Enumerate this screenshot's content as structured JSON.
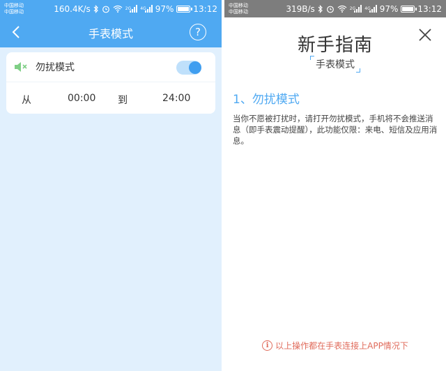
{
  "left": {
    "status": {
      "carrier_line1": "中国移动",
      "carrier_line2": "中国移动",
      "net_speed": "160.4K/s",
      "signal1_label": "2G",
      "signal2_label": "4G",
      "battery": "97%",
      "battery_level": 0.97,
      "time": "13:12"
    },
    "header": {
      "title": "手表模式"
    },
    "card": {
      "dnd_label": "勿扰模式",
      "dnd_enabled": true,
      "from_label": "从",
      "start_time": "00:00",
      "to_label": "到",
      "end_time": "24:00"
    }
  },
  "right": {
    "status": {
      "carrier_line1": "中国移动",
      "carrier_line2": "中国移动",
      "net_speed": "319B/s",
      "signal1_label": "2G",
      "signal2_label": "4G",
      "battery": "97%",
      "battery_level": 0.97,
      "time": "13:12"
    },
    "guide": {
      "title": "新手指南",
      "subtitle": "手表模式",
      "section_heading": "1、勿扰模式",
      "section_body": "当你不愿被打扰时，请打开勿扰模式，手机将不会推送消息（即手表震动提醒），此功能仅限：来电、短信及应用消息。",
      "footer_note": "以上操作都在手表连接上APP情况下"
    }
  },
  "colors": {
    "accent": "#4fa9f2",
    "left_background": "#e1f0fd",
    "footer_note": "#e06b5b"
  },
  "icons": [
    "back-icon",
    "help-icon",
    "mute-speaker-icon",
    "close-icon",
    "info-icon",
    "bluetooth-icon",
    "alarm-icon",
    "wifi-icon",
    "signal-icon",
    "battery-icon"
  ]
}
